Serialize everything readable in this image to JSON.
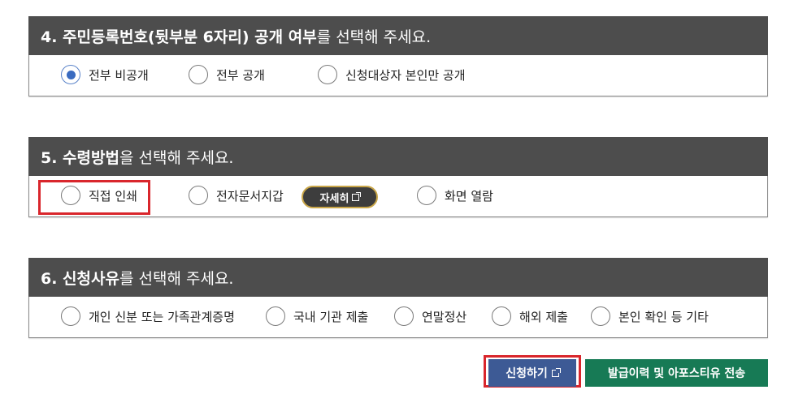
{
  "section4": {
    "title_bold": "4. 주민등록번호(뒷부분 6자리) 공개 여부",
    "title_rest": "를 선택해 주세요.",
    "options": [
      "전부 비공개",
      "전부 공개",
      "신청대상자 본인만 공개"
    ],
    "selected": "전부 비공개"
  },
  "section5": {
    "title_bold": "5. 수령방법",
    "title_rest": "을 선택해 주세요.",
    "options": [
      "직접 인쇄",
      "전자문서지갑",
      "화면 열람"
    ],
    "detail_button": "자세히"
  },
  "section6": {
    "title_bold": "6. 신청사유",
    "title_rest": "를 선택해 주세요.",
    "options": [
      "개인 신분 또는 가족관계증명",
      "국내 기관 제출",
      "연말정산",
      "해외 제출",
      "본인 확인 등 기타"
    ]
  },
  "actions": {
    "apply": "신청하기",
    "history": "발급이력 및 아포스티유 전송"
  },
  "colors": {
    "header_bg": "#4d4d4d",
    "radio_selected": "#3a6bc0",
    "highlight": "#d9262c",
    "apply_bg": "#3d5a95",
    "history_bg": "#177a55",
    "detail_border": "#c9a648"
  }
}
